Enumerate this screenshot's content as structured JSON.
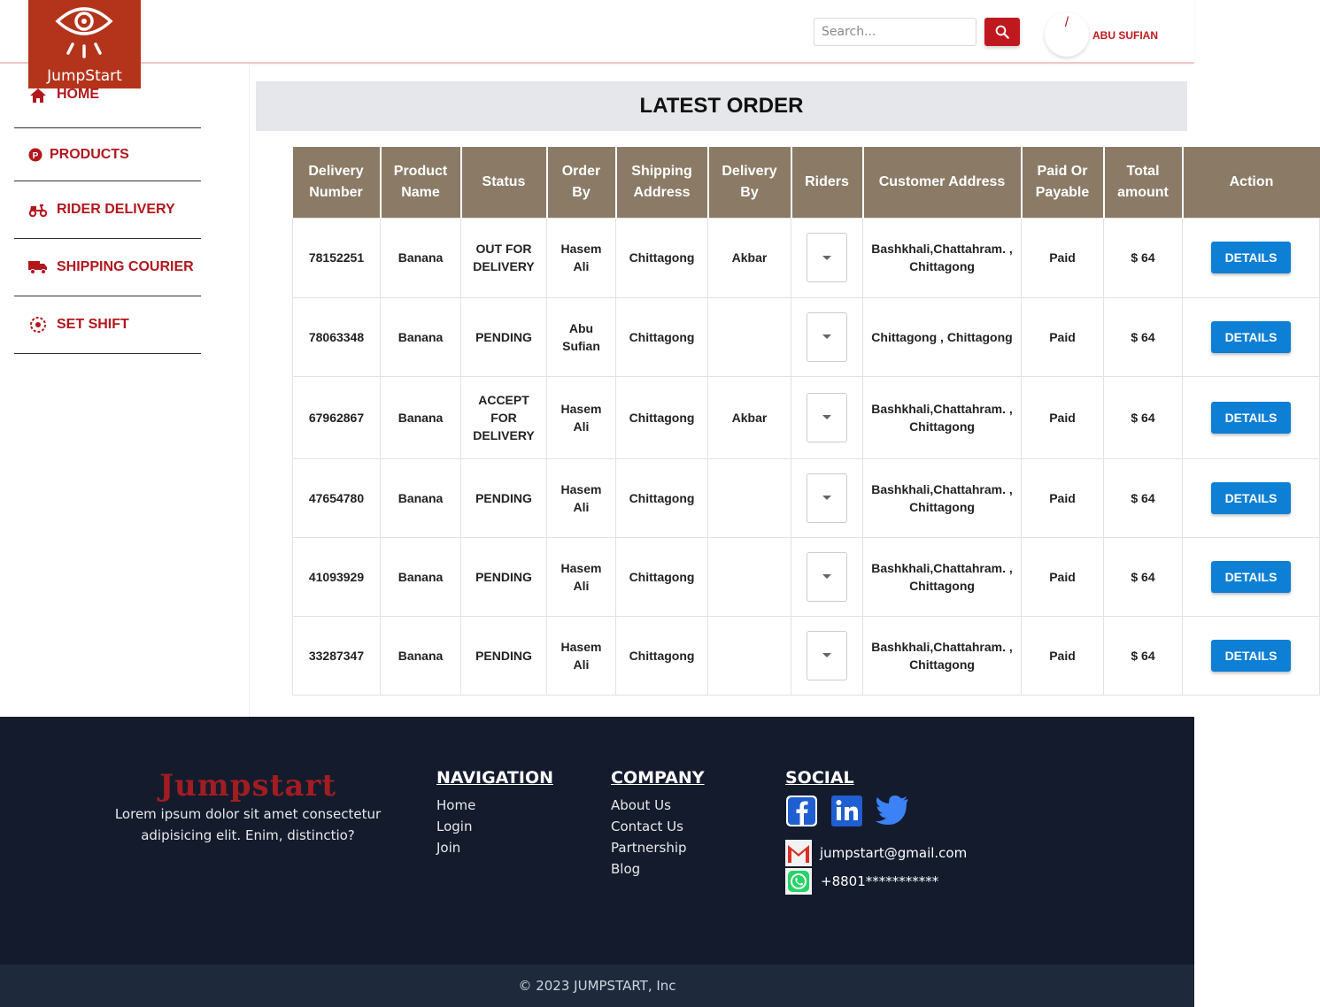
{
  "brand": {
    "logo_text": "JumpStart",
    "accent": "#b4331b"
  },
  "header": {
    "search_placeholder": "Search...",
    "user_initial": "/",
    "user_name": "ABU SUFIAN"
  },
  "sidebar": {
    "items": [
      {
        "label": "HOME",
        "icon": "home-icon"
      },
      {
        "label": "PRODUCTS",
        "icon": "product-icon"
      },
      {
        "label": "RIDER DELIVERY",
        "icon": "scooter-icon"
      },
      {
        "label": "SHIPPING COURIER",
        "icon": "truck-icon"
      },
      {
        "label": "SET SHIFT",
        "icon": "shift-icon"
      }
    ]
  },
  "page": {
    "title": "LATEST ORDER"
  },
  "table": {
    "headers": [
      "Delivery Number",
      "Product Name",
      "Status",
      "Order By",
      "Shipping Address",
      "Delivery By",
      "Riders",
      "Customer Address",
      "Paid Or Payable",
      "Total amount",
      "Action"
    ],
    "rows": [
      {
        "delivery_number": "78152251",
        "product": "Banana",
        "status": "OUT FOR DELIVERY",
        "order_by": "Hasem Ali",
        "shipping": "Chittagong",
        "delivery_by": "Akbar",
        "customer_address": "Bashkhali,Chattahram. , Chittagong",
        "paid": "Paid",
        "total": "$ 64",
        "action": "DETAILS"
      },
      {
        "delivery_number": "78063348",
        "product": "Banana",
        "status": "PENDING",
        "order_by": "Abu Sufian",
        "shipping": "Chittagong",
        "delivery_by": "",
        "customer_address": "Chittagong , Chittagong",
        "paid": "Paid",
        "total": "$ 64",
        "action": "DETAILS"
      },
      {
        "delivery_number": "67962867",
        "product": "Banana",
        "status": "ACCEPT FOR DELIVERY",
        "order_by": "Hasem Ali",
        "shipping": "Chittagong",
        "delivery_by": "Akbar",
        "customer_address": "Bashkhali,Chattahram. , Chittagong",
        "paid": "Paid",
        "total": "$ 64",
        "action": "DETAILS"
      },
      {
        "delivery_number": "47654780",
        "product": "Banana",
        "status": "PENDING",
        "order_by": "Hasem Ali",
        "shipping": "Chittagong",
        "delivery_by": "",
        "customer_address": "Bashkhali,Chattahram. , Chittagong",
        "paid": "Paid",
        "total": "$ 64",
        "action": "DETAILS"
      },
      {
        "delivery_number": "41093929",
        "product": "Banana",
        "status": "PENDING",
        "order_by": "Hasem Ali",
        "shipping": "Chittagong",
        "delivery_by": "",
        "customer_address": "Bashkhali,Chattahram. , Chittagong",
        "paid": "Paid",
        "total": "$ 64",
        "action": "DETAILS"
      },
      {
        "delivery_number": "33287347",
        "product": "Banana",
        "status": "PENDING",
        "order_by": "Hasem Ali",
        "shipping": "Chittagong",
        "delivery_by": "",
        "customer_address": "Bashkhali,Chattahram. , Chittagong",
        "paid": "Paid",
        "total": "$ 64",
        "action": "DETAILS"
      }
    ]
  },
  "footer": {
    "brand": "Jumpstart",
    "description": "Lorem ipsum dolor sit amet consectetur adipisicing elit. Enim, distinctio?",
    "navigation": {
      "title": "NAVIGATION",
      "links": [
        "Home",
        "Login",
        "Join"
      ]
    },
    "company": {
      "title": "COMPANY",
      "links": [
        "About Us",
        "Contact Us",
        "Partnership",
        "Blog"
      ]
    },
    "social": {
      "title": "SOCIAL",
      "icons": [
        "facebook-icon",
        "linkedin-icon",
        "twitter-icon"
      ],
      "email": "jumpstart@gmail.com",
      "phone": "+8801***********"
    },
    "copyright": "© 2023 JUMPSTART, Inc"
  },
  "colors": {
    "table_header": "#8b7b66",
    "details_button": "#0d7fd4",
    "footer_bg": "#141b2d",
    "nav_red": "#b3161d"
  }
}
